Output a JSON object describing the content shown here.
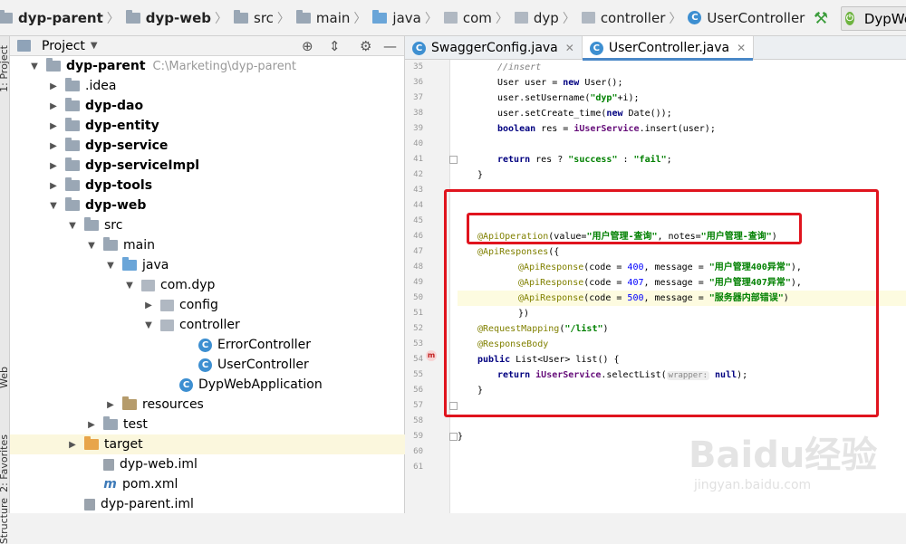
{
  "breadcrumb": [
    {
      "label": "dyp-parent",
      "bold": true,
      "icon": "folder-icon"
    },
    {
      "label": "dyp-web",
      "bold": true,
      "icon": "folder-icon"
    },
    {
      "label": "src",
      "bold": false,
      "icon": "folder-icon"
    },
    {
      "label": "main",
      "bold": false,
      "icon": "folder-icon"
    },
    {
      "label": "java",
      "bold": false,
      "icon": "source-folder-icon"
    },
    {
      "label": "com",
      "bold": false,
      "icon": "package-icon"
    },
    {
      "label": "dyp",
      "bold": false,
      "icon": "package-icon"
    },
    {
      "label": "controller",
      "bold": false,
      "icon": "package-icon"
    },
    {
      "label": "UserController",
      "bold": false,
      "icon": "class-icon"
    }
  ],
  "toolbar": {
    "run_config_label": "DypWe"
  },
  "side_tabs": {
    "project": "1: Project",
    "web": "Web",
    "favorites": "2: Favorites",
    "structure": "Structure"
  },
  "project_panel": {
    "title": "Project",
    "tree": [
      {
        "label": "dyp-parent",
        "path": "C:\\Marketing\\dyp-parent",
        "bold": true,
        "indent": 0,
        "arrow": "down",
        "icon": "module"
      },
      {
        "label": ".idea",
        "bold": false,
        "indent": 1,
        "arrow": "right",
        "icon": "folder"
      },
      {
        "label": "dyp-dao",
        "bold": true,
        "indent": 1,
        "arrow": "right",
        "icon": "module"
      },
      {
        "label": "dyp-entity",
        "bold": true,
        "indent": 1,
        "arrow": "right",
        "icon": "module"
      },
      {
        "label": "dyp-service",
        "bold": true,
        "indent": 1,
        "arrow": "right",
        "icon": "module"
      },
      {
        "label": "dyp-serviceImpl",
        "bold": true,
        "indent": 1,
        "arrow": "right",
        "icon": "module"
      },
      {
        "label": "dyp-tools",
        "bold": true,
        "indent": 1,
        "arrow": "right",
        "icon": "module"
      },
      {
        "label": "dyp-web",
        "bold": true,
        "indent": 1,
        "arrow": "down",
        "icon": "module"
      },
      {
        "label": "src",
        "bold": false,
        "indent": 2,
        "arrow": "down",
        "icon": "folder"
      },
      {
        "label": "main",
        "bold": false,
        "indent": 3,
        "arrow": "down",
        "icon": "folder"
      },
      {
        "label": "java",
        "bold": false,
        "indent": 4,
        "arrow": "down",
        "icon": "source"
      },
      {
        "label": "com.dyp",
        "bold": false,
        "indent": 5,
        "arrow": "down",
        "icon": "package"
      },
      {
        "label": "config",
        "bold": false,
        "indent": 6,
        "arrow": "right",
        "icon": "package"
      },
      {
        "label": "controller",
        "bold": false,
        "indent": 6,
        "arrow": "down",
        "icon": "package"
      },
      {
        "label": "ErrorController",
        "bold": false,
        "indent": 8,
        "arrow": "",
        "icon": "class"
      },
      {
        "label": "UserController",
        "bold": false,
        "indent": 8,
        "arrow": "",
        "icon": "class"
      },
      {
        "label": "DypWebApplication",
        "bold": false,
        "indent": 7,
        "arrow": "",
        "icon": "class"
      },
      {
        "label": "resources",
        "bold": false,
        "indent": 4,
        "arrow": "right",
        "icon": "resources"
      },
      {
        "label": "test",
        "bold": false,
        "indent": 3,
        "arrow": "right",
        "icon": "folder"
      },
      {
        "label": "target",
        "bold": false,
        "indent": 2,
        "arrow": "right",
        "icon": "target",
        "selected": true
      },
      {
        "label": "dyp-web.iml",
        "bold": false,
        "indent": 3,
        "arrow": "",
        "icon": "file"
      },
      {
        "label": "pom.xml",
        "bold": false,
        "indent": 3,
        "arrow": "",
        "icon": "maven"
      },
      {
        "label": "dyp-parent.iml",
        "bold": false,
        "indent": 2,
        "arrow": "",
        "icon": "file"
      }
    ]
  },
  "editor": {
    "tabs": [
      {
        "label": "SwaggerConfig.java",
        "active": false
      },
      {
        "label": "UserController.java",
        "active": true
      }
    ],
    "line_numbers": [
      "35",
      "36",
      "37",
      "38",
      "39",
      "40",
      "41",
      "42",
      "43",
      "44",
      "45",
      "46",
      "47",
      "48",
      "49",
      "50",
      "51",
      "52",
      "53",
      "54",
      "55",
      "56",
      "57",
      "58",
      "59",
      "60",
      "61"
    ],
    "code": {
      "l35": "//insert",
      "l36a": "User user = ",
      "l36b": "new",
      "l36c": " User();",
      "l37a": "user.setUsername(",
      "l37b": "\"dyp\"",
      "l37c": "+i);",
      "l38a": "user.setCreate_time(",
      "l38b": "new",
      "l38c": " Date());",
      "l39a": "boolean",
      "l39b": " res = ",
      "l39c": "iUserService",
      "l39d": ".insert(user);",
      "l41a": "return",
      "l41b": " res ? ",
      "l41c": "\"success\"",
      "l41d": " : ",
      "l41e": "\"fail\"",
      "l41f": ";",
      "l42": "}",
      "l46a": "@ApiOperation",
      "l46b": "(value=",
      "l46c": "\"用户管理-查询\"",
      "l46d": ", notes=",
      "l46e": "\"用户管理-查询\"",
      "l46f": ")",
      "l47a": "@ApiResponses",
      "l47b": "({",
      "l48a": "@ApiResponse",
      "l48b": "(code = ",
      "l48c": "400",
      "l48d": ", message = ",
      "l48e": "\"用户管理400异常\"",
      "l48f": "),",
      "l49a": "@ApiResponse",
      "l49b": "(code = ",
      "l49c": "407",
      "l49d": ", message = ",
      "l49e": "\"用户管理407异常\"",
      "l49f": "),",
      "l50a": "@ApiResponse",
      "l50b": "(code = ",
      "l50c": "500",
      "l50d": ", message = ",
      "l50e": "\"服务器内部错误\"",
      "l50f": ")",
      "l51": "})",
      "l52a": "@RequestMapping",
      "l52b": "(",
      "l52c": "\"/list\"",
      "l52d": ")",
      "l53": "@ResponseBody",
      "l54a": "public",
      "l54b": " List<User> list() {",
      "l55a": "return",
      "l55b": " ",
      "l55c": "iUserService",
      "l55d": ".selectList(",
      "l55e": "wrapper:",
      "l55f": " null",
      "l55g": ");",
      "l56": "}",
      "l59": "}"
    }
  },
  "watermark": {
    "logo": "Baidu经验",
    "url": "jingyan.baidu.com"
  },
  "colors": {
    "annotation_box": "#e0141e",
    "selection": "#fbf7dd",
    "tab_accent": "#4a88c7"
  }
}
